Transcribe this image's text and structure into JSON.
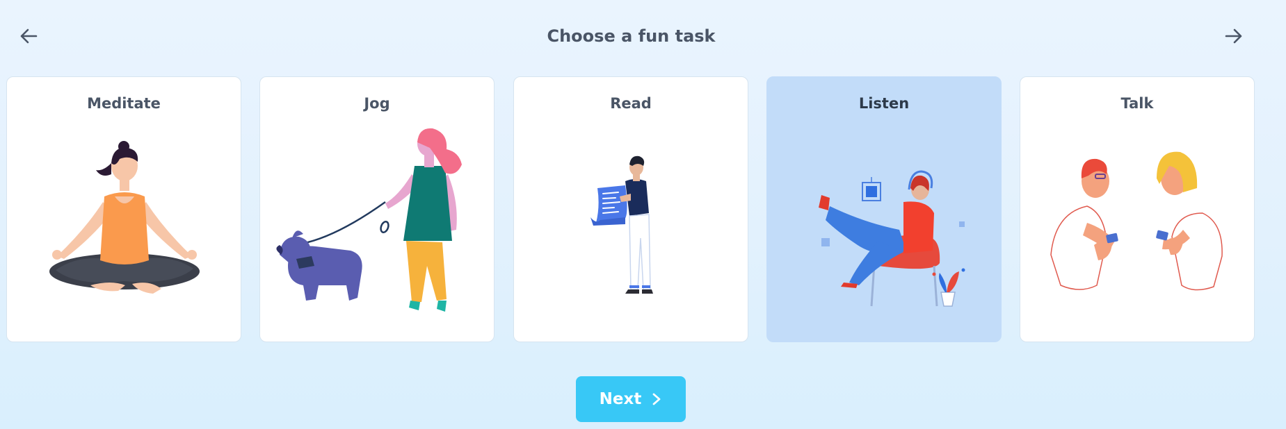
{
  "header": {
    "title": "Choose a fun task",
    "back_icon": "arrow-left-icon",
    "forward_icon": "arrow-right-icon"
  },
  "tasks": [
    {
      "label": "Meditate",
      "illustration": "meditating-woman",
      "selected": false
    },
    {
      "label": "Jog",
      "illustration": "woman-walking-dog",
      "selected": false
    },
    {
      "label": "Read",
      "illustration": "man-reading-scroll",
      "selected": false
    },
    {
      "label": "Listen",
      "illustration": "woman-listening-headphones",
      "selected": true
    },
    {
      "label": "Talk",
      "illustration": "two-people-chatting",
      "selected": false
    }
  ],
  "footer": {
    "next_label": "Next",
    "next_icon": "chevron-right-icon"
  },
  "colors": {
    "background": "#e6f3fd",
    "card": "#ffffff",
    "card_selected": "#c2dcf9",
    "button": "#38c8f6",
    "text": "#4a5566"
  }
}
